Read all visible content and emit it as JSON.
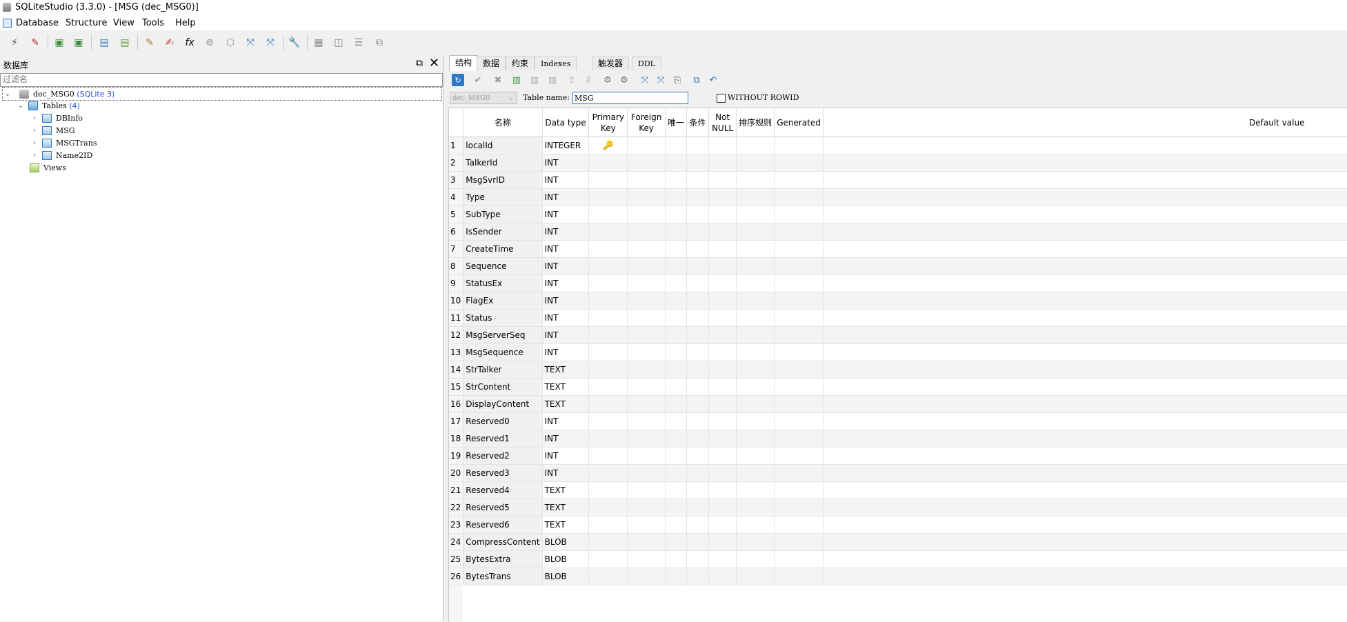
{
  "window": {
    "title": "SQLiteStudio (3.3.0) - [MSG (dec_MSG0)]"
  },
  "menu": [
    "Database",
    "Structure",
    "View",
    "Tools",
    "Help"
  ],
  "dock": {
    "title": "数据库",
    "filter_placeholder": "过滤名",
    "database": {
      "name": "dec_MSG0",
      "type": "(SQLite 3)"
    },
    "tables_label": "Tables",
    "tables_count": "(4)",
    "tables": [
      "DBInfo",
      "MSG",
      "MSGTrans",
      "Name2ID"
    ],
    "views_label": "Views"
  },
  "tabs": [
    "结构",
    "数据",
    "约束",
    "Indexes",
    "触发器",
    "DDL"
  ],
  "namebar": {
    "db_combo": "dec_MSG0",
    "table_name_label": "Table name:",
    "table_name": "MSG",
    "without_rowid": "WITHOUT ROWID"
  },
  "grid": {
    "headers": [
      "名称",
      "Data type",
      "Primary\nKey",
      "Foreign\nKey",
      "唯一",
      "条件",
      "Not\nNULL",
      "排序规则",
      "Generated",
      "Default value"
    ],
    "rows": [
      {
        "n": "1",
        "name": "localId",
        "type": "INTEGER",
        "pk": true
      },
      {
        "n": "2",
        "name": "TalkerId",
        "type": "INT"
      },
      {
        "n": "3",
        "name": "MsgSvrID",
        "type": "INT"
      },
      {
        "n": "4",
        "name": "Type",
        "type": "INT"
      },
      {
        "n": "5",
        "name": "SubType",
        "type": "INT"
      },
      {
        "n": "6",
        "name": "IsSender",
        "type": "INT"
      },
      {
        "n": "7",
        "name": "CreateTime",
        "type": "INT"
      },
      {
        "n": "8",
        "name": "Sequence",
        "type": "INT"
      },
      {
        "n": "9",
        "name": "StatusEx",
        "type": "INT"
      },
      {
        "n": "10",
        "name": "FlagEx",
        "type": "INT"
      },
      {
        "n": "11",
        "name": "Status",
        "type": "INT"
      },
      {
        "n": "12",
        "name": "MsgServerSeq",
        "type": "INT"
      },
      {
        "n": "13",
        "name": "MsgSequence",
        "type": "INT"
      },
      {
        "n": "14",
        "name": "StrTalker",
        "type": "TEXT"
      },
      {
        "n": "15",
        "name": "StrContent",
        "type": "TEXT"
      },
      {
        "n": "16",
        "name": "DisplayContent",
        "type": "TEXT"
      },
      {
        "n": "17",
        "name": "Reserved0",
        "type": "INT"
      },
      {
        "n": "18",
        "name": "Reserved1",
        "type": "INT"
      },
      {
        "n": "19",
        "name": "Reserved2",
        "type": "INT"
      },
      {
        "n": "20",
        "name": "Reserved3",
        "type": "INT"
      },
      {
        "n": "21",
        "name": "Reserved4",
        "type": "TEXT"
      },
      {
        "n": "22",
        "name": "Reserved5",
        "type": "TEXT"
      },
      {
        "n": "23",
        "name": "Reserved6",
        "type": "TEXT"
      },
      {
        "n": "24",
        "name": "CompressContent",
        "type": "BLOB"
      },
      {
        "n": "25",
        "name": "BytesExtra",
        "type": "BLOB"
      },
      {
        "n": "26",
        "name": "BytesTrans",
        "type": "BLOB"
      }
    ]
  }
}
